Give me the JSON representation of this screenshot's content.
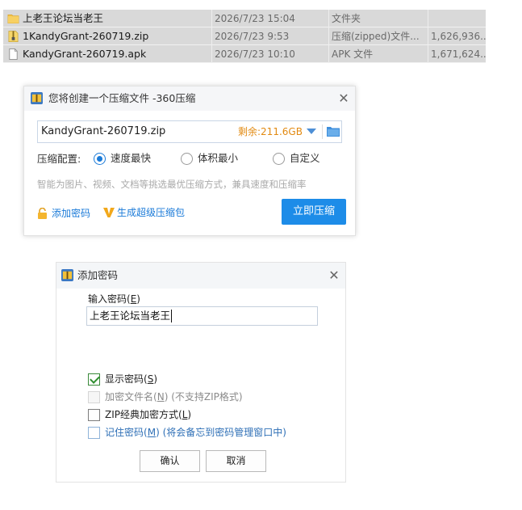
{
  "explorer": {
    "rows": [
      {
        "name": "上老王论坛当老王",
        "date": "2026/7/23 15:04",
        "type": "文件夹",
        "size": "",
        "icon": "folder-icon"
      },
      {
        "name": "1KandyGrant-260719.zip",
        "date": "2026/7/23 9:53",
        "type": "压缩(zipped)文件...",
        "size": "1,626,936...",
        "icon": "zip-file-icon"
      },
      {
        "name": "KandyGrant-260719.apk",
        "date": "2026/7/23 10:10",
        "type": "APK 文件",
        "size": "1,671,624...",
        "icon": "file-icon"
      }
    ]
  },
  "compress_dialog": {
    "title": "您将创建一个压缩文件 -360压缩",
    "filename": "KandyGrant-260719.zip",
    "free_space": "剩余:211.6GB",
    "config_label": "压缩配置:",
    "options": [
      {
        "label": "速度最快",
        "selected": true
      },
      {
        "label": "体积最小",
        "selected": false
      },
      {
        "label": "自定义",
        "selected": false
      }
    ],
    "hint": "智能为图片、视频、文档等挑选最优压缩方式，兼具速度和压缩率",
    "add_password_label": "添加密码",
    "super_package_label": "生成超级压缩包",
    "compress_button": "立即压缩"
  },
  "password_dialog": {
    "title": "添加密码",
    "input_label": "输入密码",
    "input_label_key": "E",
    "password_value": "上老王论坛当老王",
    "checkboxes": [
      {
        "label": "显示密码",
        "key": "S",
        "suffix": "",
        "checked": true,
        "disabled": false
      },
      {
        "label": "加密文件名",
        "key": "N",
        "suffix": " (不支持ZIP格式)",
        "checked": false,
        "disabled": true
      },
      {
        "label": "ZIP经典加密方式",
        "key": "L",
        "suffix": "",
        "checked": false,
        "disabled": false
      },
      {
        "label": "记住密码",
        "key": "M",
        "suffix": " (将会备忘到密码管理窗口中)",
        "checked": false,
        "disabled": false
      }
    ],
    "ok_label": "确认",
    "cancel_label": "取消"
  },
  "colors": {
    "accent": "#1d8ce8",
    "link": "#1a7ad8",
    "free_space": "#e28a12",
    "selection_row": "#d9d9d9"
  }
}
